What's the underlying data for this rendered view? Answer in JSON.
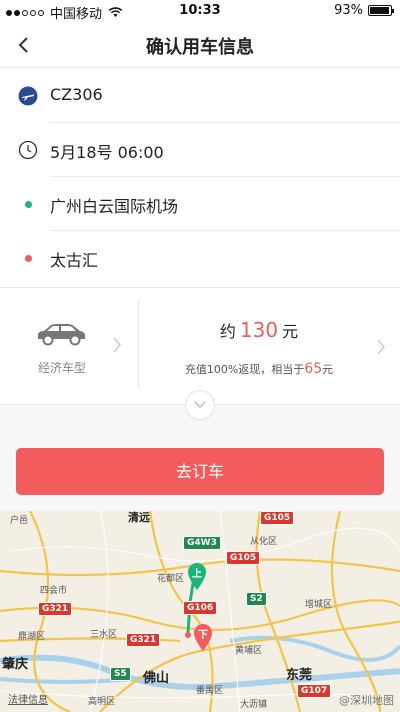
{
  "status_bar": {
    "carrier": "中国移动",
    "time": "10:33",
    "battery": "93%",
    "battery_level": 0.93
  },
  "nav": {
    "title": "确认用车信息"
  },
  "trip": {
    "flight": "CZ306",
    "datetime": "5月18号 06:00",
    "pickup": "广州白云国际机场",
    "dropoff": "太古汇"
  },
  "car": {
    "type_label": "经济车型"
  },
  "price": {
    "prefix": "约",
    "amount": "130",
    "unit": "元",
    "promo_text": "充值100%返现，相当于",
    "promo_amount": "65",
    "promo_unit": "元"
  },
  "book_button": "去订车",
  "colors": {
    "accent": "#f25c5c",
    "pickup_dot": "#1bb57a",
    "dropoff_dot": "#f25c5c",
    "flight_icon": "#2a4d8f"
  },
  "map": {
    "places": [
      "清远",
      "从化区",
      "花都区",
      "四会市",
      "增城区",
      "鼎湖区",
      "三水区",
      "黄埔区",
      "肇庆",
      "佛山",
      "东莞",
      "高明区",
      "番禺区",
      "大沥镇"
    ],
    "roads": [
      "G105",
      "G4W3",
      "G105",
      "G321",
      "G106",
      "S2",
      "G321",
      "S5",
      "G107"
    ],
    "pickup_marker": "上",
    "dropoff_marker": "下",
    "legal": "法律信息",
    "watermark": "@深圳地图"
  }
}
